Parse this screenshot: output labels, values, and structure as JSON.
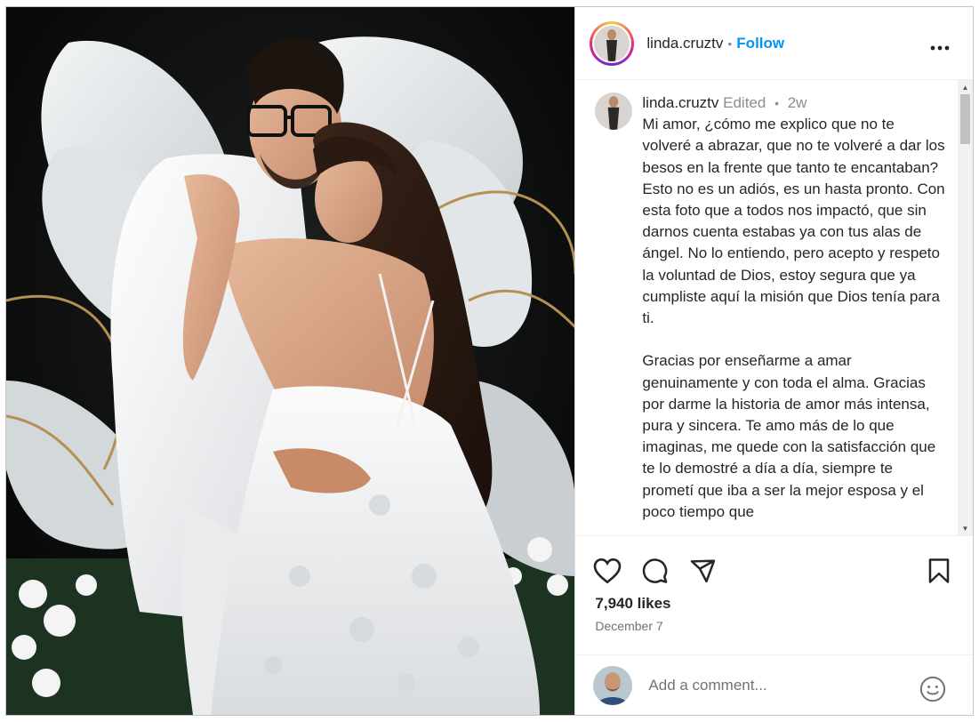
{
  "post": {
    "username": "linda.cruztv",
    "follow_label": "Follow",
    "separator": "•",
    "edited": "Edited",
    "age": "2w",
    "caption": "Mi amor, ¿cómo me explico que no te volveré a abrazar, que no te volveré a dar los besos en la frente que tanto te encantaban? Esto no es un adiós, es un hasta pronto. Con esta foto que a todos nos impactó, que sin darnos cuenta estabas ya con tus alas de ángel. No lo entiendo, pero acepto y respeto la voluntad de Dios, estoy segura que ya cumpliste aquí la misión que Dios tenía para ti.\n\nGracias por enseñarme a amar genuinamente y con toda el alma. Gracias por darme la historia de amor más intensa, pura y sincera. Te amo más de lo que imaginas, me quede con la satisfacción que te lo demostré a día a día, siempre te prometí que iba a ser la mejor esposa y el poco tiempo que",
    "likes": "7,940 likes",
    "date": "December 7",
    "comment_placeholder": "Add a comment..."
  },
  "icons": {
    "more": "more-options-icon",
    "like": "heart-icon",
    "comment": "comment-bubble-icon",
    "share": "send-paper-plane-icon",
    "save": "bookmark-icon",
    "emoji": "emoji-smiley-icon"
  },
  "colors": {
    "follow": "#0095f6",
    "text": "#262626",
    "muted": "#737373",
    "border": "#dbdbdb"
  }
}
